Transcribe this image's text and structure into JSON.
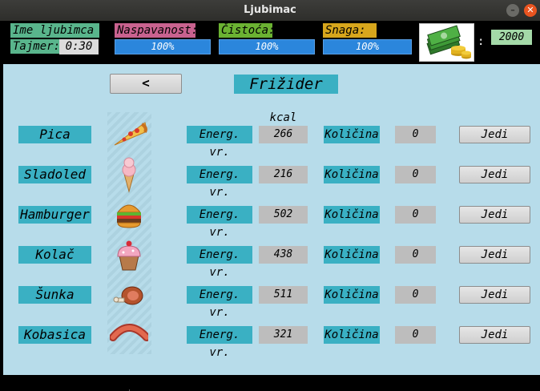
{
  "window": {
    "title": "Ljubimac"
  },
  "status": {
    "pet_name_label": "Ime ljubimca",
    "timer_label": "Tajmer:",
    "timer_value": "0:30",
    "stats": [
      {
        "label": "Naspavanost:",
        "value": "100%",
        "level": 1.0,
        "color": "#c9628f"
      },
      {
        "label": "Čistoća:",
        "value": "100%",
        "level": 1.0,
        "color": "#6bb232"
      },
      {
        "label": "Snaga:",
        "value": "100%",
        "level": 1.0,
        "color": "#d7a61c"
      }
    ],
    "money_icon": "money-stack-icon",
    "money_separator": ":",
    "money_value": "2000"
  },
  "fridge": {
    "back_label": "<",
    "title": "Frižider",
    "kcal_header": "kcal",
    "energy_label": "Energ. vr.",
    "quantity_label": "Količina",
    "eat_label": "Jedi",
    "items": [
      {
        "name": "Pica",
        "icon": "pizza-icon",
        "kcal": "266",
        "quantity": "0"
      },
      {
        "name": "Sladoled",
        "icon": "ice-cream-icon",
        "kcal": "216",
        "quantity": "0"
      },
      {
        "name": "Hamburger",
        "icon": "hamburger-icon",
        "kcal": "502",
        "quantity": "0"
      },
      {
        "name": "Kolač",
        "icon": "cupcake-icon",
        "kcal": "438",
        "quantity": "0"
      },
      {
        "name": "Šunka",
        "icon": "ham-icon",
        "kcal": "511",
        "quantity": "0"
      },
      {
        "name": "Kobasica",
        "icon": "sausage-icon",
        "kcal": "321",
        "quantity": "0"
      }
    ]
  }
}
